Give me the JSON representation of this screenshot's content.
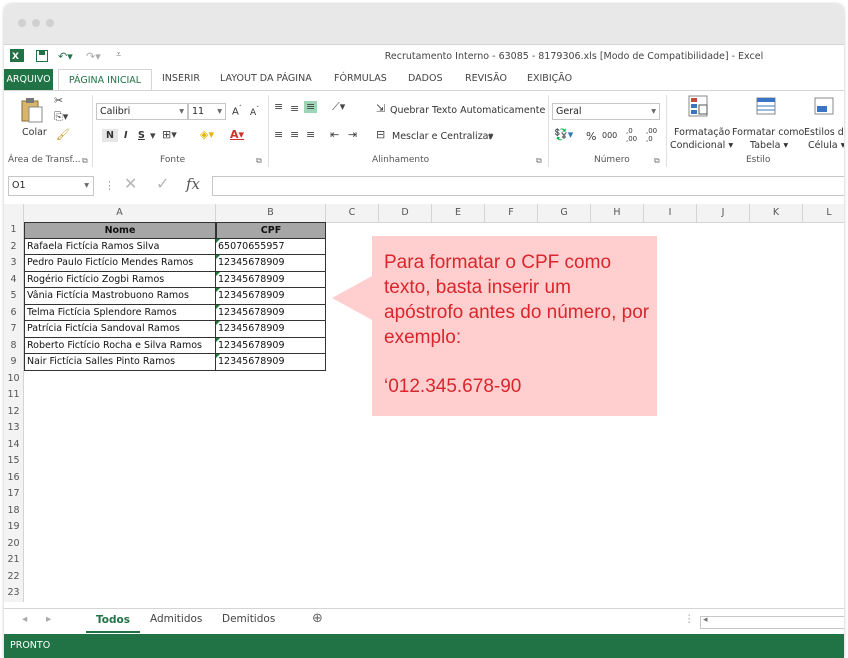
{
  "window": {
    "title": "Recrutamento Interno - 63085 - 8179306.xls  [Modo de Compatibilidade] - Excel",
    "app_icon": "excel-icon"
  },
  "ribbon_tabs": [
    {
      "label": "ARQUIVO"
    },
    {
      "label": "PÁGINA INICIAL"
    },
    {
      "label": "INSERIR"
    },
    {
      "label": "LAYOUT DA PÁGINA"
    },
    {
      "label": "FÓRMULAS"
    },
    {
      "label": "DADOS"
    },
    {
      "label": "REVISÃO"
    },
    {
      "label": "EXIBIÇÃO"
    }
  ],
  "ribbon": {
    "paste_label": "Colar",
    "clipboard_label": "Área de Transf...",
    "font_name": "Calibri",
    "font_size": "11",
    "bold": "N",
    "italic": "I",
    "underline": "S",
    "font_group_label": "Fonte",
    "wrap_text": "Quebrar Texto Automaticamente",
    "merge_center": "Mesclar e Centralizar",
    "alignment_group_label": "Alinhamento",
    "number_format": "Geral",
    "percent": "%",
    "thousands": "000",
    "dec_inc": ",0 ,00",
    "dec_dec": ",00 ,0",
    "number_group_label": "Número",
    "cond_format_1": "Formatação",
    "cond_format_2": "Condicional ▾",
    "format_table_1": "Formatar como",
    "format_table_2": "Tabela ▾",
    "cell_styles_1": "Estilos de",
    "cell_styles_2": "Célula ▾",
    "style_group_label": "Estilo"
  },
  "formula_bar": {
    "name_box": "O1",
    "fx": "fx",
    "content": ""
  },
  "columns": [
    "A",
    "B",
    "C",
    "D",
    "E",
    "F",
    "G",
    "H",
    "I",
    "J",
    "K",
    "L"
  ],
  "row_numbers": [
    "1",
    "2",
    "3",
    "4",
    "5",
    "6",
    "7",
    "8",
    "9",
    "10",
    "11",
    "12",
    "13",
    "14",
    "15",
    "16",
    "17",
    "18",
    "19",
    "20",
    "21",
    "22",
    "23"
  ],
  "table": {
    "headers": [
      "Nome",
      "CPF"
    ],
    "rows": [
      [
        "Rafaela Fictícia Ramos Silva",
        "65070655957"
      ],
      [
        "Pedro Paulo Fictício Mendes Ramos",
        "12345678909"
      ],
      [
        "Rogério Fictício Zogbi Ramos",
        "12345678909"
      ],
      [
        "Vânia Fictícia Mastrobuono Ramos",
        "12345678909"
      ],
      [
        "Telma Fictícia Splendore Ramos",
        "12345678909"
      ],
      [
        "Patrícia Fictícia Sandoval Ramos",
        "12345678909"
      ],
      [
        "Roberto Fictício Rocha e Silva Ramos",
        "12345678909"
      ],
      [
        "Nair Fictícia Salles Pinto Ramos",
        "12345678909"
      ]
    ],
    "header_color": "#a6a6a6"
  },
  "callout": {
    "text": "Para formatar o CPF como texto, basta inserir um apóstrofo antes do número, por exemplo:",
    "example": "‘012.345.678-90",
    "bg_color": "#ffcfcf",
    "text_color": "#d9262d"
  },
  "sheets": [
    {
      "label": "Todos",
      "active": true
    },
    {
      "label": "Admitidos",
      "active": false
    },
    {
      "label": "Demitidos",
      "active": false
    }
  ],
  "status": {
    "text": "PRONTO",
    "color": "#217346"
  }
}
